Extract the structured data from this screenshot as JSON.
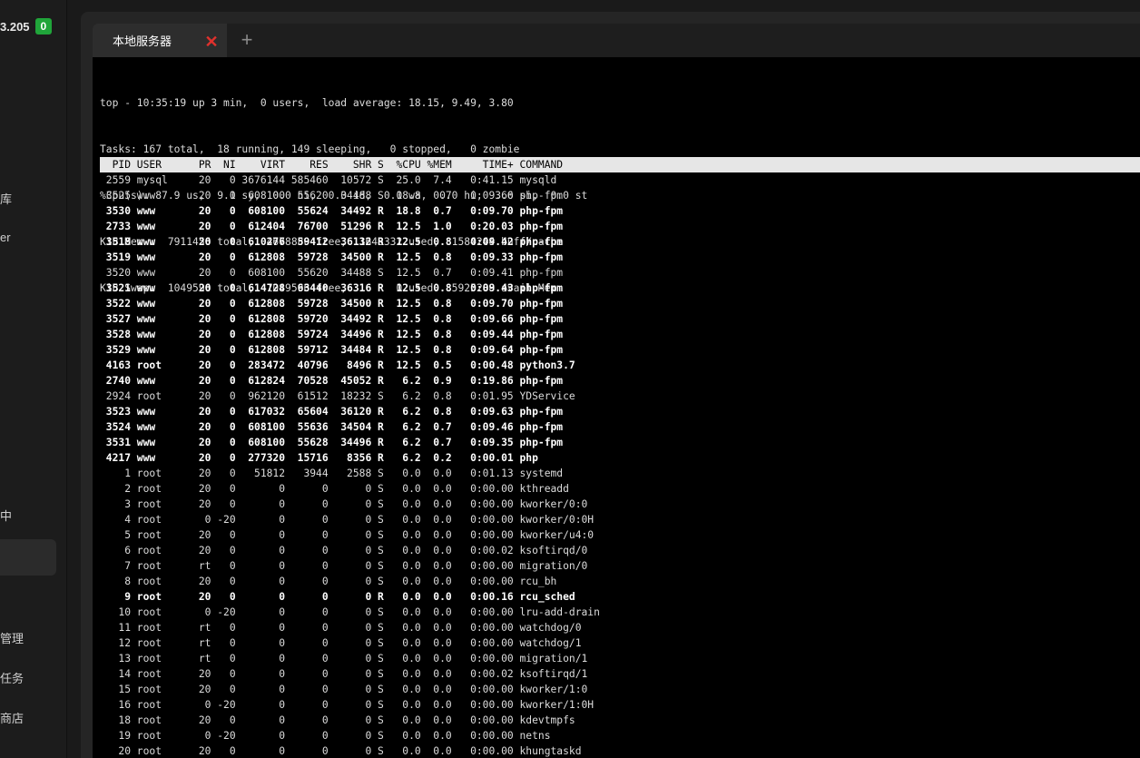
{
  "sidebar": {
    "ip_text": "3.205",
    "ip_badge": "0",
    "items": [
      {
        "label": "库",
        "y": 0
      },
      {
        "label": "er",
        "y": 1
      },
      {
        "label": "中",
        "y": 2
      },
      {
        "label": "管理",
        "y": 3
      },
      {
        "label": "任务",
        "y": 4
      },
      {
        "label": "商店",
        "y": 5
      }
    ]
  },
  "tabs": {
    "active_label": "本地服务器",
    "close_icon": "close-icon",
    "add_icon": "plus-icon"
  },
  "terminal": {
    "summary": [
      "top - 10:35:19 up 3 min,  0 users,  load average: 18.15, 9.49, 3.80",
      "Tasks: 167 total,  18 running, 149 sleeping,   0 stopped,   0 zombie",
      "%Cpu(s): 87.9 us,  9.1 sy,  0.0 ni,  0.0 id,  0.0 wa,  0.0 hi,  3.0 si,  0.0 st",
      "KiB Mem :  7911456 total,  4678880 free,  1648332 used,  1584244 buff/cache",
      "KiB Swap:  1049596 total,  1049596 free,        0 used.  5925288 avail Mem"
    ],
    "header": "  PID USER      PR  NI    VIRT    RES    SHR S  %CPU %MEM     TIME+ COMMAND",
    "processes": [
      {
        "pid": "2559",
        "user": "mysql",
        "pr": "20",
        "ni": "0",
        "virt": "3676144",
        "res": "585460",
        "shr": "10572",
        "s": "S",
        "cpu": "25.0",
        "mem": "7.4",
        "time": "0:41.15",
        "cmd": "mysqld"
      },
      {
        "pid": "3525",
        "user": "www",
        "pr": "20",
        "ni": "0",
        "virt": "608100",
        "res": "55620",
        "shr": "34488",
        "s": "S",
        "cpu": "18.8",
        "mem": "0.7",
        "time": "0:09.66",
        "cmd": "php-fpm"
      },
      {
        "pid": "3530",
        "user": "www",
        "pr": "20",
        "ni": "0",
        "virt": "608100",
        "res": "55624",
        "shr": "34492",
        "s": "R",
        "cpu": "18.8",
        "mem": "0.7",
        "time": "0:09.70",
        "cmd": "php-fpm"
      },
      {
        "pid": "2733",
        "user": "www",
        "pr": "20",
        "ni": "0",
        "virt": "612404",
        "res": "76700",
        "shr": "51296",
        "s": "R",
        "cpu": "12.5",
        "mem": "1.0",
        "time": "0:20.03",
        "cmd": "php-fpm"
      },
      {
        "pid": "3518",
        "user": "www",
        "pr": "20",
        "ni": "0",
        "virt": "610276",
        "res": "59412",
        "shr": "36132",
        "s": "R",
        "cpu": "12.5",
        "mem": "0.8",
        "time": "0:09.42",
        "cmd": "php-fpm"
      },
      {
        "pid": "3519",
        "user": "www",
        "pr": "20",
        "ni": "0",
        "virt": "612808",
        "res": "59728",
        "shr": "34500",
        "s": "R",
        "cpu": "12.5",
        "mem": "0.8",
        "time": "0:09.33",
        "cmd": "php-fpm"
      },
      {
        "pid": "3520",
        "user": "www",
        "pr": "20",
        "ni": "0",
        "virt": "608100",
        "res": "55620",
        "shr": "34488",
        "s": "S",
        "cpu": "12.5",
        "mem": "0.7",
        "time": "0:09.41",
        "cmd": "php-fpm"
      },
      {
        "pid": "3521",
        "user": "www",
        "pr": "20",
        "ni": "0",
        "virt": "614728",
        "res": "63440",
        "shr": "36316",
        "s": "R",
        "cpu": "12.5",
        "mem": "0.8",
        "time": "0:09.43",
        "cmd": "php-fpm"
      },
      {
        "pid": "3522",
        "user": "www",
        "pr": "20",
        "ni": "0",
        "virt": "612808",
        "res": "59728",
        "shr": "34500",
        "s": "R",
        "cpu": "12.5",
        "mem": "0.8",
        "time": "0:09.70",
        "cmd": "php-fpm"
      },
      {
        "pid": "3527",
        "user": "www",
        "pr": "20",
        "ni": "0",
        "virt": "612808",
        "res": "59720",
        "shr": "34492",
        "s": "R",
        "cpu": "12.5",
        "mem": "0.8",
        "time": "0:09.66",
        "cmd": "php-fpm"
      },
      {
        "pid": "3528",
        "user": "www",
        "pr": "20",
        "ni": "0",
        "virt": "612808",
        "res": "59724",
        "shr": "34496",
        "s": "R",
        "cpu": "12.5",
        "mem": "0.8",
        "time": "0:09.44",
        "cmd": "php-fpm"
      },
      {
        "pid": "3529",
        "user": "www",
        "pr": "20",
        "ni": "0",
        "virt": "612808",
        "res": "59712",
        "shr": "34484",
        "s": "R",
        "cpu": "12.5",
        "mem": "0.8",
        "time": "0:09.64",
        "cmd": "php-fpm"
      },
      {
        "pid": "4163",
        "user": "root",
        "pr": "20",
        "ni": "0",
        "virt": "283472",
        "res": "40796",
        "shr": "8496",
        "s": "R",
        "cpu": "12.5",
        "mem": "0.5",
        "time": "0:00.48",
        "cmd": "python3.7"
      },
      {
        "pid": "2740",
        "user": "www",
        "pr": "20",
        "ni": "0",
        "virt": "612824",
        "res": "70528",
        "shr": "45052",
        "s": "R",
        "cpu": "6.2",
        "mem": "0.9",
        "time": "0:19.86",
        "cmd": "php-fpm"
      },
      {
        "pid": "2924",
        "user": "root",
        "pr": "20",
        "ni": "0",
        "virt": "962120",
        "res": "61512",
        "shr": "18232",
        "s": "S",
        "cpu": "6.2",
        "mem": "0.8",
        "time": "0:01.95",
        "cmd": "YDService"
      },
      {
        "pid": "3523",
        "user": "www",
        "pr": "20",
        "ni": "0",
        "virt": "617032",
        "res": "65604",
        "shr": "36120",
        "s": "R",
        "cpu": "6.2",
        "mem": "0.8",
        "time": "0:09.63",
        "cmd": "php-fpm"
      },
      {
        "pid": "3524",
        "user": "www",
        "pr": "20",
        "ni": "0",
        "virt": "608100",
        "res": "55636",
        "shr": "34504",
        "s": "R",
        "cpu": "6.2",
        "mem": "0.7",
        "time": "0:09.46",
        "cmd": "php-fpm"
      },
      {
        "pid": "3531",
        "user": "www",
        "pr": "20",
        "ni": "0",
        "virt": "608100",
        "res": "55628",
        "shr": "34496",
        "s": "R",
        "cpu": "6.2",
        "mem": "0.7",
        "time": "0:09.35",
        "cmd": "php-fpm"
      },
      {
        "pid": "4217",
        "user": "www",
        "pr": "20",
        "ni": "0",
        "virt": "277320",
        "res": "15716",
        "shr": "8356",
        "s": "R",
        "cpu": "6.2",
        "mem": "0.2",
        "time": "0:00.01",
        "cmd": "php"
      },
      {
        "pid": "1",
        "user": "root",
        "pr": "20",
        "ni": "0",
        "virt": "51812",
        "res": "3944",
        "shr": "2588",
        "s": "S",
        "cpu": "0.0",
        "mem": "0.0",
        "time": "0:01.13",
        "cmd": "systemd"
      },
      {
        "pid": "2",
        "user": "root",
        "pr": "20",
        "ni": "0",
        "virt": "0",
        "res": "0",
        "shr": "0",
        "s": "S",
        "cpu": "0.0",
        "mem": "0.0",
        "time": "0:00.00",
        "cmd": "kthreadd"
      },
      {
        "pid": "3",
        "user": "root",
        "pr": "20",
        "ni": "0",
        "virt": "0",
        "res": "0",
        "shr": "0",
        "s": "S",
        "cpu": "0.0",
        "mem": "0.0",
        "time": "0:00.00",
        "cmd": "kworker/0:0"
      },
      {
        "pid": "4",
        "user": "root",
        "pr": "0",
        "ni": "-20",
        "virt": "0",
        "res": "0",
        "shr": "0",
        "s": "S",
        "cpu": "0.0",
        "mem": "0.0",
        "time": "0:00.00",
        "cmd": "kworker/0:0H"
      },
      {
        "pid": "5",
        "user": "root",
        "pr": "20",
        "ni": "0",
        "virt": "0",
        "res": "0",
        "shr": "0",
        "s": "S",
        "cpu": "0.0",
        "mem": "0.0",
        "time": "0:00.00",
        "cmd": "kworker/u4:0"
      },
      {
        "pid": "6",
        "user": "root",
        "pr": "20",
        "ni": "0",
        "virt": "0",
        "res": "0",
        "shr": "0",
        "s": "S",
        "cpu": "0.0",
        "mem": "0.0",
        "time": "0:00.02",
        "cmd": "ksoftirqd/0"
      },
      {
        "pid": "7",
        "user": "root",
        "pr": "rt",
        "ni": "0",
        "virt": "0",
        "res": "0",
        "shr": "0",
        "s": "S",
        "cpu": "0.0",
        "mem": "0.0",
        "time": "0:00.00",
        "cmd": "migration/0"
      },
      {
        "pid": "8",
        "user": "root",
        "pr": "20",
        "ni": "0",
        "virt": "0",
        "res": "0",
        "shr": "0",
        "s": "S",
        "cpu": "0.0",
        "mem": "0.0",
        "time": "0:00.00",
        "cmd": "rcu_bh"
      },
      {
        "pid": "9",
        "user": "root",
        "pr": "20",
        "ni": "0",
        "virt": "0",
        "res": "0",
        "shr": "0",
        "s": "R",
        "cpu": "0.0",
        "mem": "0.0",
        "time": "0:00.16",
        "cmd": "rcu_sched"
      },
      {
        "pid": "10",
        "user": "root",
        "pr": "0",
        "ni": "-20",
        "virt": "0",
        "res": "0",
        "shr": "0",
        "s": "S",
        "cpu": "0.0",
        "mem": "0.0",
        "time": "0:00.00",
        "cmd": "lru-add-drain"
      },
      {
        "pid": "11",
        "user": "root",
        "pr": "rt",
        "ni": "0",
        "virt": "0",
        "res": "0",
        "shr": "0",
        "s": "S",
        "cpu": "0.0",
        "mem": "0.0",
        "time": "0:00.00",
        "cmd": "watchdog/0"
      },
      {
        "pid": "12",
        "user": "root",
        "pr": "rt",
        "ni": "0",
        "virt": "0",
        "res": "0",
        "shr": "0",
        "s": "S",
        "cpu": "0.0",
        "mem": "0.0",
        "time": "0:00.00",
        "cmd": "watchdog/1"
      },
      {
        "pid": "13",
        "user": "root",
        "pr": "rt",
        "ni": "0",
        "virt": "0",
        "res": "0",
        "shr": "0",
        "s": "S",
        "cpu": "0.0",
        "mem": "0.0",
        "time": "0:00.00",
        "cmd": "migration/1"
      },
      {
        "pid": "14",
        "user": "root",
        "pr": "20",
        "ni": "0",
        "virt": "0",
        "res": "0",
        "shr": "0",
        "s": "S",
        "cpu": "0.0",
        "mem": "0.0",
        "time": "0:00.02",
        "cmd": "ksoftirqd/1"
      },
      {
        "pid": "15",
        "user": "root",
        "pr": "20",
        "ni": "0",
        "virt": "0",
        "res": "0",
        "shr": "0",
        "s": "S",
        "cpu": "0.0",
        "mem": "0.0",
        "time": "0:00.00",
        "cmd": "kworker/1:0"
      },
      {
        "pid": "16",
        "user": "root",
        "pr": "0",
        "ni": "-20",
        "virt": "0",
        "res": "0",
        "shr": "0",
        "s": "S",
        "cpu": "0.0",
        "mem": "0.0",
        "time": "0:00.00",
        "cmd": "kworker/1:0H"
      },
      {
        "pid": "18",
        "user": "root",
        "pr": "20",
        "ni": "0",
        "virt": "0",
        "res": "0",
        "shr": "0",
        "s": "S",
        "cpu": "0.0",
        "mem": "0.0",
        "time": "0:00.00",
        "cmd": "kdevtmpfs"
      },
      {
        "pid": "19",
        "user": "root",
        "pr": "0",
        "ni": "-20",
        "virt": "0",
        "res": "0",
        "shr": "0",
        "s": "S",
        "cpu": "0.0",
        "mem": "0.0",
        "time": "0:00.00",
        "cmd": "netns"
      },
      {
        "pid": "20",
        "user": "root",
        "pr": "20",
        "ni": "0",
        "virt": "0",
        "res": "0",
        "shr": "0",
        "s": "S",
        "cpu": "0.0",
        "mem": "0.0",
        "time": "0:00.00",
        "cmd": "khungtaskd"
      }
    ]
  },
  "colors": {
    "badge": "#20a53a",
    "close": "#e0312d",
    "terminal_bg": "#000000",
    "header_bg": "#e6e6e6"
  }
}
